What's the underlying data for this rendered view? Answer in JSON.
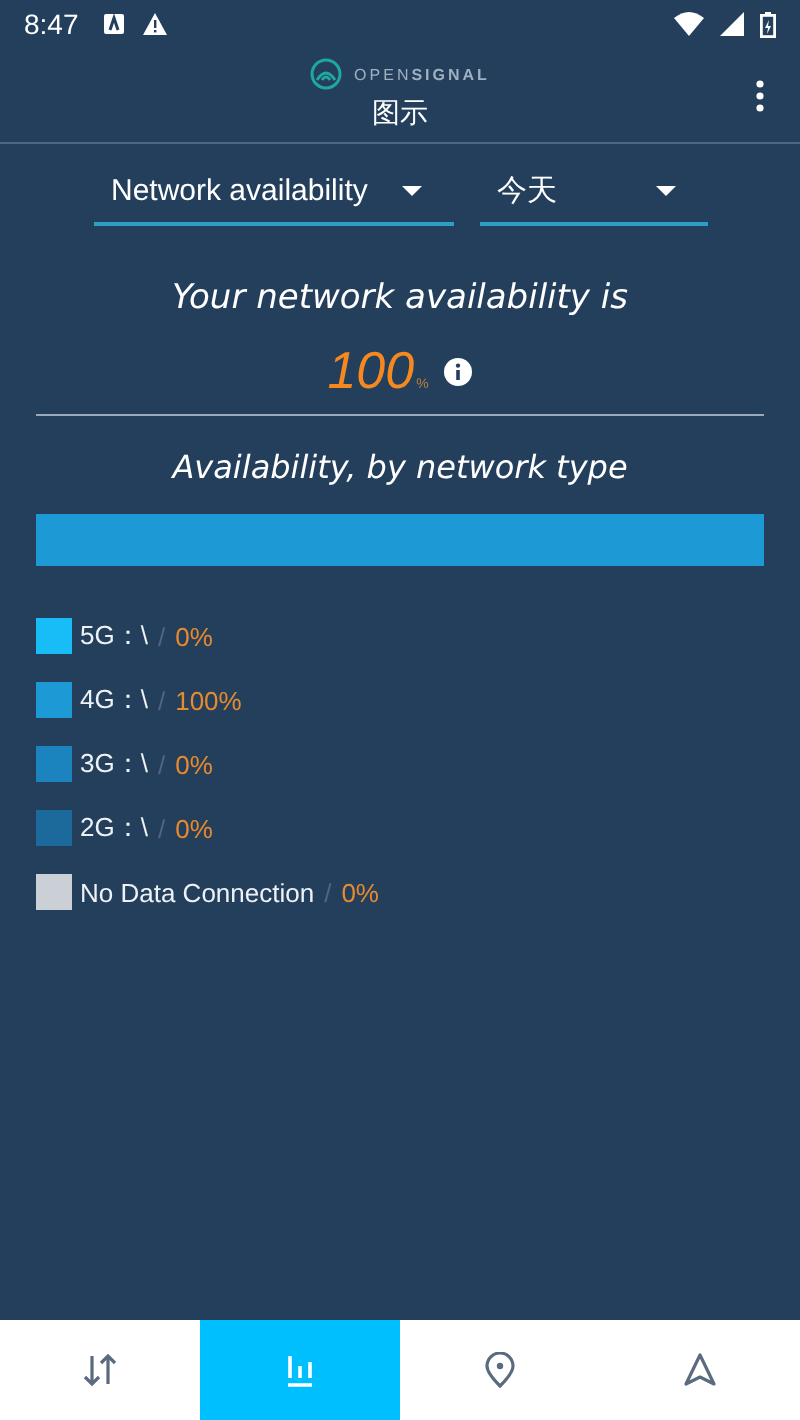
{
  "status_bar": {
    "time": "8:47"
  },
  "header": {
    "logo": "OPEN**SIGNAL**",
    "title": "图示"
  },
  "filters": [
    {
      "value": "Network availability"
    },
    {
      "value": "今天"
    }
  ],
  "summary": {
    "heading": "Your network availability is",
    "value": "100",
    "unit": "%"
  },
  "breakdown": {
    "heading": "Availability, by network type",
    "items": [
      {
        "label": "5G：\\",
        "separator": "/",
        "value": "0%",
        "color": "#18bdf8",
        "level": 0
      },
      {
        "label": "4G：\\",
        "separator": "/",
        "value": "100%",
        "color": "#1d9ad6",
        "level": 1
      },
      {
        "label": "3G：\\",
        "separator": "/",
        "value": "0%",
        "color": "#1b84be",
        "level": 0
      },
      {
        "label": "2G：\\",
        "separator": "/",
        "value": "0%",
        "color": "#1c6a9c",
        "level": 0
      },
      {
        "label": "No Data Connection",
        "separator": "/",
        "value": "0%",
        "color": "#cbd0d6",
        "level": 0
      }
    ]
  },
  "bottom_nav": [
    {
      "kind": "data",
      "selected": false
    },
    {
      "kind": "chart",
      "selected": true
    },
    {
      "kind": "location",
      "selected": false
    },
    {
      "kind": "navigate",
      "selected": false
    }
  ]
}
